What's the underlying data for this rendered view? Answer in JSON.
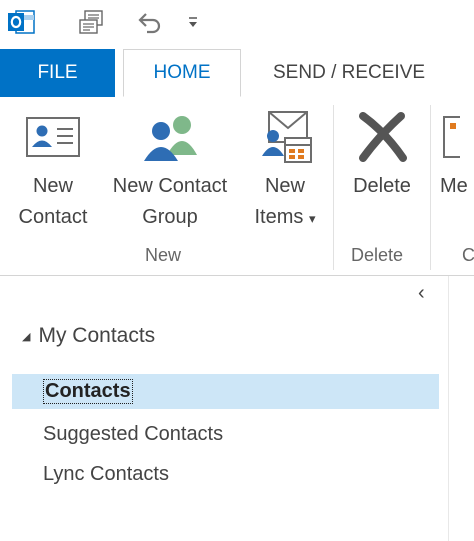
{
  "qat": {
    "app_icon": "outlook-icon",
    "send_receive_icon": "send-receive-all-icon",
    "undo_icon": "undo-icon",
    "customize_icon": "customize-qat-icon"
  },
  "tabs": {
    "file": "FILE",
    "home": "HOME",
    "send_receive": "SEND / RECEIVE"
  },
  "ribbon": {
    "new_contact": {
      "line1": "New",
      "line2": "Contact",
      "icon": "contact-card-icon"
    },
    "new_contact_group": {
      "line1": "New Contact",
      "line2": "Group",
      "icon": "contact-group-icon"
    },
    "new_items": {
      "line1": "New",
      "line2": "Items",
      "dropdown": "▾",
      "icon": "new-items-icon"
    },
    "group_new": "New",
    "delete": {
      "label": "Delete",
      "icon": "delete-x-icon"
    },
    "group_delete": "Delete",
    "partial_next": "Me",
    "partial_group": "C"
  },
  "nav": {
    "collapse_glyph": "‹",
    "root": {
      "expand_glyph": "◢",
      "label": "My Contacts"
    },
    "folders": [
      {
        "label": "Contacts",
        "selected": true
      },
      {
        "label": "Suggested Contacts",
        "selected": false
      },
      {
        "label": "Lync Contacts",
        "selected": false
      }
    ]
  },
  "colors": {
    "accent": "#0072c6",
    "selection": "#cde6f7"
  }
}
